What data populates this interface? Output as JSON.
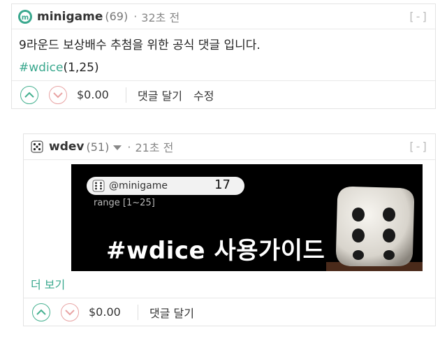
{
  "comment1": {
    "username": "minigame",
    "reputation": "(69)",
    "separator": "·",
    "time": "32초 전",
    "collapse": "[-]",
    "text": "9라운드 보상배수 추첨을 위한 공식 댓글 입니다.",
    "tag": "#wdice",
    "tag_args": "(1,25)",
    "amount": "$0.00",
    "reply": "댓글 달기",
    "edit": "수정"
  },
  "comment2": {
    "username": "wdev",
    "reputation": "(51)",
    "separator": "·",
    "time": "21초 전",
    "collapse": "[-]",
    "banner": {
      "pill_user": "@minigame",
      "pill_number": "17",
      "range": "range [1~25]",
      "title": "#wdice 사용가이드"
    },
    "more": "더 보기",
    "amount": "$0.00",
    "reply": "댓글 달기"
  },
  "colors": {
    "accent": "#3aa88e",
    "upvote": "#44b08f",
    "downvote": "#e8a3a3"
  },
  "icons": [
    "minigame-avatar-icon",
    "dice-avatar-icon",
    "caret-down-icon",
    "upvote-icon",
    "downvote-icon",
    "dice-icon"
  ]
}
